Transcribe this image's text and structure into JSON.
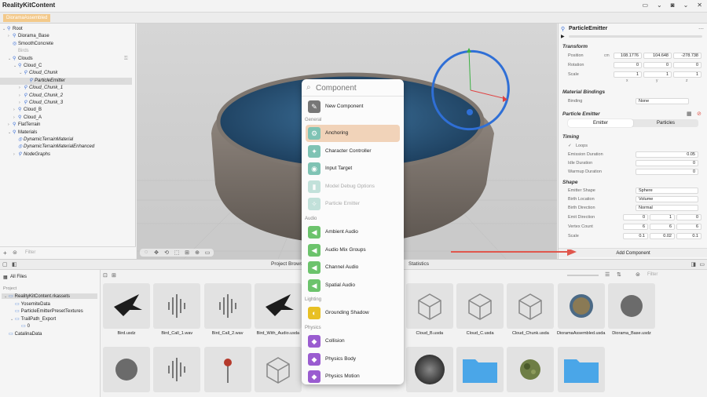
{
  "app": {
    "title": "RealityKitContent",
    "doc_tab": "DioramaAssembled"
  },
  "toolbar_icons": [
    "headset-icon",
    "chevron-down-icon",
    "camera-icon",
    "chevron-down-icon",
    "window-close-icon"
  ],
  "scene_tree": [
    {
      "label": "Root",
      "depth": 0,
      "chev": "⌄",
      "icon": "⚲",
      "style": ""
    },
    {
      "label": "Diorama_Base",
      "depth": 1,
      "chev": "›",
      "icon": "⚲",
      "style": ""
    },
    {
      "label": "SmoothConcrete",
      "depth": 1,
      "chev": "",
      "icon": "◎",
      "style": ""
    },
    {
      "label": "Birds",
      "depth": 1,
      "chev": "",
      "icon": "",
      "style": "dim"
    },
    {
      "label": "Clouds",
      "depth": 1,
      "chev": "⌄",
      "icon": "⚲",
      "style": ""
    },
    {
      "label": "Cloud_C",
      "depth": 2,
      "chev": "⌄",
      "icon": "⚲",
      "style": ""
    },
    {
      "label": "Cloud_Chunk",
      "depth": 3,
      "chev": "⌄",
      "icon": "⚲",
      "style": "it"
    },
    {
      "label": "ParticleEmitter",
      "depth": 4,
      "chev": "",
      "icon": "⚲",
      "style": "it sel"
    },
    {
      "label": "Cloud_Chunk_1",
      "depth": 3,
      "chev": "›",
      "icon": "⚲",
      "style": "it"
    },
    {
      "label": "Cloud_Chunk_2",
      "depth": 3,
      "chev": "›",
      "icon": "⚲",
      "style": "it"
    },
    {
      "label": "Cloud_Chunk_3",
      "depth": 3,
      "chev": "›",
      "icon": "⚲",
      "style": "it"
    },
    {
      "label": "Cloud_B",
      "depth": 2,
      "chev": "›",
      "icon": "⚲",
      "style": ""
    },
    {
      "label": "Cloud_A",
      "depth": 2,
      "chev": "›",
      "icon": "⚲",
      "style": ""
    },
    {
      "label": "FlatTerrain",
      "depth": 1,
      "chev": "›",
      "icon": "⚲",
      "style": ""
    },
    {
      "label": "Materials",
      "depth": 1,
      "chev": "⌄",
      "icon": "⚲",
      "style": ""
    },
    {
      "label": "DynamicTerrainMaterial",
      "depth": 2,
      "chev": "",
      "icon": "◎",
      "style": "it"
    },
    {
      "label": "DynamicTerrainMaterialEnhanced",
      "depth": 2,
      "chev": "",
      "icon": "◎",
      "style": "it"
    },
    {
      "label": "NodeGraphs",
      "depth": 2,
      "chev": "›",
      "icon": "⚲",
      "style": "it"
    }
  ],
  "left_footer": {
    "filter_placeholder": "Filter"
  },
  "inspector": {
    "entity_name": "ParticleEmitter",
    "transform": {
      "title": "Transform",
      "unit": "cm",
      "labels": {
        "position": "Position",
        "rotation": "Rotation",
        "scale": "Scale"
      },
      "position": [
        "108.1776",
        "104.648",
        "-278.738"
      ],
      "rotation": [
        "0",
        "0",
        "0"
      ],
      "scale": [
        "1",
        "1",
        "1"
      ],
      "axes": [
        "x",
        "y",
        "z"
      ]
    },
    "material_bindings": {
      "title": "Material Bindings",
      "binding_label": "Binding",
      "binding_value": "None"
    },
    "particle_emitter": {
      "title": "Particle Emitter",
      "tab_emitter": "Emitter",
      "tab_particles": "Particles"
    },
    "timing": {
      "title": "Timing",
      "loops": "Loops",
      "emission_duration": "Emission Duration",
      "emission_value": "0.05",
      "idle_duration": "Idle Duration",
      "idle_value": "0",
      "warmup_duration": "Warmup Duration",
      "warmup_value": "0"
    },
    "shape": {
      "title": "Shape",
      "emitter_shape": "Emitter Shape",
      "emitter_shape_value": "Sphere",
      "birth_location": "Birth Location",
      "birth_location_value": "Volume",
      "birth_direction": "Birth Direction",
      "birth_direction_value": "Normal",
      "emit_direction": "Emit Direction",
      "emit_direction_values": [
        "0",
        "1",
        "0"
      ],
      "vertex_count": "Vertex Count",
      "vertex_count_values": [
        "6",
        "6",
        "6"
      ],
      "scale": "Scale",
      "scale_values": [
        "0.1",
        "0.02",
        "0.1"
      ]
    },
    "add_component": "Add Component"
  },
  "component_popup": {
    "search_placeholder": "Component",
    "new_component": "New Component",
    "sections": [
      {
        "header": "General",
        "items": [
          {
            "label": "Anchoring",
            "icon": "anchor-icon",
            "glyph": "⚙",
            "color": "#7fc3b4",
            "highlight": true,
            "disabled": false
          },
          {
            "label": "Character Controller",
            "icon": "character-controller-icon",
            "glyph": "✦",
            "color": "#7fc3b4",
            "highlight": false,
            "disabled": false
          },
          {
            "label": "Input Target",
            "icon": "input-target-icon",
            "glyph": "◉",
            "color": "#7fc3b4",
            "highlight": false,
            "disabled": false
          },
          {
            "label": "Model Debug Options",
            "icon": "debug-options-icon",
            "glyph": "▮",
            "color": "#7fc3b4",
            "highlight": false,
            "disabled": true
          },
          {
            "label": "Particle Emitter",
            "icon": "particle-emitter-icon",
            "glyph": "✧",
            "color": "#7fc3b4",
            "highlight": false,
            "disabled": true
          }
        ]
      },
      {
        "header": "Audio",
        "items": [
          {
            "label": "Ambient Audio",
            "icon": "speaker-icon",
            "glyph": "◀",
            "color": "#6cc36c",
            "highlight": false,
            "disabled": false
          },
          {
            "label": "Audio Mix Groups",
            "icon": "speaker-icon",
            "glyph": "◀",
            "color": "#6cc36c",
            "highlight": false,
            "disabled": false
          },
          {
            "label": "Channel Audio",
            "icon": "speaker-icon",
            "glyph": "◀",
            "color": "#6cc36c",
            "highlight": false,
            "disabled": false
          },
          {
            "label": "Spatial Audio",
            "icon": "speaker-icon",
            "glyph": "◀",
            "color": "#6cc36c",
            "highlight": false,
            "disabled": false
          }
        ]
      },
      {
        "header": "Lighting",
        "items": [
          {
            "label": "Grounding Shadow",
            "icon": "lightbulb-icon",
            "glyph": "◐",
            "color": "#e8c024",
            "highlight": false,
            "disabled": false
          }
        ]
      },
      {
        "header": "Physics",
        "items": [
          {
            "label": "Collision",
            "icon": "collision-icon",
            "glyph": "◆",
            "color": "#9a5cd0",
            "highlight": false,
            "disabled": false
          },
          {
            "label": "Physics Body",
            "icon": "physics-body-icon",
            "glyph": "◆",
            "color": "#9a5cd0",
            "highlight": false,
            "disabled": false
          },
          {
            "label": "Physics Motion",
            "icon": "physics-motion-icon",
            "glyph": "◆",
            "color": "#9a5cd0",
            "highlight": false,
            "disabled": false
          }
        ]
      }
    ]
  },
  "bottom": {
    "tabs": {
      "project_browser": "Project Browser",
      "statistics": "Statistics"
    },
    "sidebar": {
      "all_files": "All Files",
      "project_header": "Project",
      "items": [
        {
          "label": "RealityKitContent.rkassets",
          "depth": 0,
          "chev": "⌄",
          "sel": true
        },
        {
          "label": "YosemiteData",
          "depth": 1,
          "chev": "",
          "sel": false
        },
        {
          "label": "ParticleEmitterPresetTextures",
          "depth": 1,
          "chev": "",
          "sel": false
        },
        {
          "label": "TrailPath_Export",
          "depth": 1,
          "chev": "⌄",
          "sel": false
        },
        {
          "label": "0",
          "depth": 2,
          "chev": "",
          "sel": false
        },
        {
          "label": "CatalinaData",
          "depth": 0,
          "chev": "",
          "sel": false
        }
      ]
    },
    "filter_placeholder": "Filter",
    "files_row1": [
      {
        "name": "Bird.usdz",
        "kind": "bird"
      },
      {
        "name": "Bird_Call_1.wav",
        "kind": "audio"
      },
      {
        "name": "Bird_Call_2.wav",
        "kind": "audio"
      },
      {
        "name": "Bird_With_Audio.usda",
        "kind": "bird"
      },
      {
        "name": "",
        "kind": "hidden"
      },
      {
        "name": "Cloud_A.usda",
        "kind": "cube"
      },
      {
        "name": "Cloud_B.usda",
        "kind": "cube"
      },
      {
        "name": "Cloud_C.usda",
        "kind": "cube"
      },
      {
        "name": "Cloud_Chunk.usda",
        "kind": "cube"
      },
      {
        "name": "DioramaAssembled.usda",
        "kind": "globe"
      },
      {
        "name": "Diorama_Base.usdz",
        "kind": "disc"
      }
    ],
    "files_row2": [
      {
        "name": "",
        "kind": "disc"
      },
      {
        "name": "",
        "kind": "audio"
      },
      {
        "name": "",
        "kind": "pin"
      },
      {
        "name": "",
        "kind": "cube"
      },
      {
        "name": "",
        "kind": "hidden"
      },
      {
        "name": "",
        "kind": "hidden"
      },
      {
        "name": "",
        "kind": "sphere"
      },
      {
        "name": "",
        "kind": "folder"
      },
      {
        "name": "",
        "kind": "camo"
      },
      {
        "name": "",
        "kind": "folder"
      }
    ]
  },
  "colors": {
    "accent_tab": "#f3c98a",
    "highlight": "#f1d3b9",
    "arrow": "#e0574d",
    "gizmo_ring": "#2f6fd6"
  }
}
